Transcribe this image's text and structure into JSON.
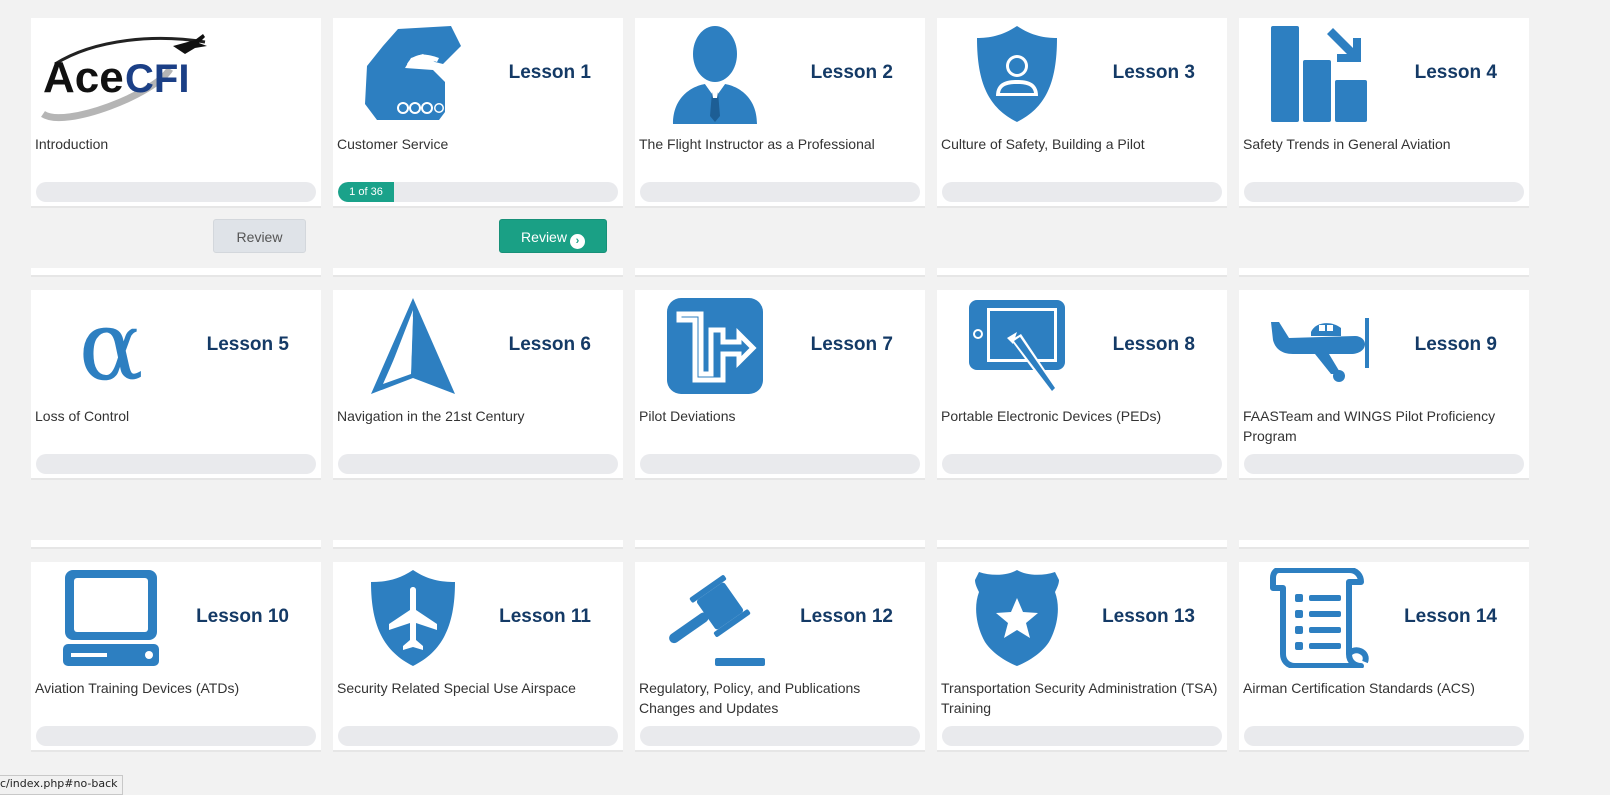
{
  "colors": {
    "icon_blue": "#2d7fc1",
    "label_navy": "#143a66",
    "progress_green": "#1aa28a",
    "page_background": "#f2f2f2"
  },
  "cards": [
    {
      "lesson_label": "",
      "title": "Introduction",
      "icon": "acecfi-logo",
      "progress_text": "",
      "progress_fraction": 0,
      "logo_text_ace": "Ace",
      "logo_text_cfi": "CFI"
    },
    {
      "lesson_label": "Lesson 1",
      "title": "Customer Service",
      "icon": "handshake-icon",
      "progress_text": "1 of 36",
      "progress_fraction": 0.0278
    },
    {
      "lesson_label": "Lesson 2",
      "title": "The Flight Instructor as a Professional",
      "icon": "businessman-icon",
      "progress_text": "",
      "progress_fraction": 0
    },
    {
      "lesson_label": "Lesson 3",
      "title": "Culture of Safety, Building a Pilot",
      "icon": "user-shield-icon",
      "progress_text": "",
      "progress_fraction": 0
    },
    {
      "lesson_label": "Lesson 4",
      "title": "Safety Trends in General Aviation",
      "icon": "bar-chart-down-icon",
      "progress_text": "",
      "progress_fraction": 0
    },
    {
      "lesson_label": "Lesson 5",
      "title": "Loss of Control",
      "icon": "alpha-icon",
      "icon_glyph": "α",
      "progress_text": "",
      "progress_fraction": 0
    },
    {
      "lesson_label": "Lesson 6",
      "title": "Navigation in the 21st Century",
      "icon": "navigation-arrow-icon",
      "progress_text": "",
      "progress_fraction": 0
    },
    {
      "lesson_label": "Lesson 7",
      "title": "Pilot Deviations",
      "icon": "deviation-path-icon",
      "progress_text": "",
      "progress_fraction": 0
    },
    {
      "lesson_label": "Lesson 8",
      "title": "Portable Electronic Devices (PEDs)",
      "icon": "tablet-stylus-icon",
      "progress_text": "",
      "progress_fraction": 0
    },
    {
      "lesson_label": "Lesson 9",
      "title": "FAASTeam and WINGS Pilot Proficiency Program",
      "icon": "airplane-side-icon",
      "progress_text": "",
      "progress_fraction": 0
    },
    {
      "lesson_label": "Lesson 10",
      "title": "Aviation Training Devices (ATDs)",
      "icon": "computer-icon",
      "progress_text": "",
      "progress_fraction": 0
    },
    {
      "lesson_label": "Lesson 11",
      "title": "Security Related Special Use Airspace",
      "icon": "airplane-shield-icon",
      "progress_text": "",
      "progress_fraction": 0
    },
    {
      "lesson_label": "Lesson 12",
      "title": "Regulatory, Policy, and Publications Changes and Updates",
      "icon": "gavel-icon",
      "progress_text": "",
      "progress_fraction": 0
    },
    {
      "lesson_label": "Lesson 13",
      "title": "Transportation Security Administration (TSA) Training",
      "icon": "police-badge-icon",
      "progress_text": "",
      "progress_fraction": 0
    },
    {
      "lesson_label": "Lesson 14",
      "title": "Airman Certification Standards (ACS)",
      "icon": "scroll-list-icon",
      "progress_text": "",
      "progress_fraction": 0
    }
  ],
  "buttons": {
    "intro_review": "Review",
    "lesson1_review": "Review",
    "lesson1_review_icon": "chevron-circle-right-icon"
  },
  "status_bar": {
    "url": "c/index.php#no-back"
  }
}
